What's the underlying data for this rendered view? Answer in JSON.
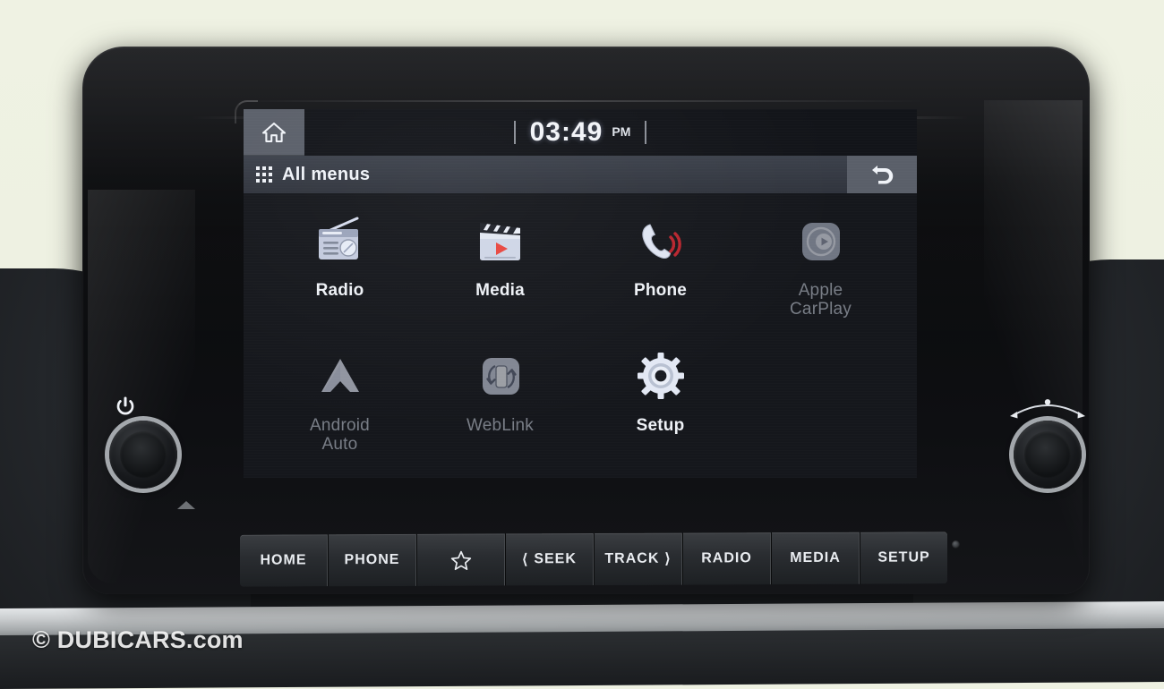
{
  "device": {
    "name": "Kia UVO infotainment head unit",
    "watermark": "© DUBICARS.com"
  },
  "screen": {
    "statusbar": {
      "home_icon": "home-icon",
      "time": "03:49",
      "meridiem": "PM"
    },
    "menubar": {
      "grid_icon": "apps-grid-icon",
      "title": "All menus",
      "back_icon": "back-arrow-icon"
    },
    "apps": [
      {
        "label": "Radio",
        "icon": "radio-icon",
        "enabled": true
      },
      {
        "label": "Media",
        "icon": "media-clapper-icon",
        "enabled": true
      },
      {
        "label": "Phone",
        "icon": "phone-icon",
        "enabled": true
      },
      {
        "label": "Apple\nCarPlay",
        "icon": "apple-carplay-icon",
        "enabled": false
      },
      {
        "label": "Android\nAuto",
        "icon": "android-auto-icon",
        "enabled": false
      },
      {
        "label": "WebLink",
        "icon": "weblink-icon",
        "enabled": false
      },
      {
        "label": "Setup",
        "icon": "setup-gear-icon",
        "enabled": true
      }
    ]
  },
  "hardware": {
    "buttons": [
      {
        "label": "HOME",
        "icon": null
      },
      {
        "label": "PHONE",
        "icon": null
      },
      {
        "label": "",
        "icon": "star-icon"
      },
      {
        "label": "SEEK",
        "icon": "seek-prev-icon"
      },
      {
        "label": "TRACK",
        "icon": "track-next-icon"
      },
      {
        "label": "RADIO",
        "icon": null
      },
      {
        "label": "MEDIA",
        "icon": null
      },
      {
        "label": "SETUP",
        "icon": null
      }
    ],
    "left_knob": {
      "name": "power-volume-knob",
      "icon": "power-icon"
    },
    "right_knob": {
      "name": "tune-knob",
      "icon": "tune-arc-icon"
    }
  },
  "colors": {
    "background": "#eef1e2",
    "screen_bg": "#15171c",
    "accent_gray": "#5a5f69",
    "menubar": "#343943",
    "text_active": "#eef1f6",
    "text_dim": "#787d86",
    "phone_red": "#b8252e",
    "media_red": "#e8473f"
  }
}
